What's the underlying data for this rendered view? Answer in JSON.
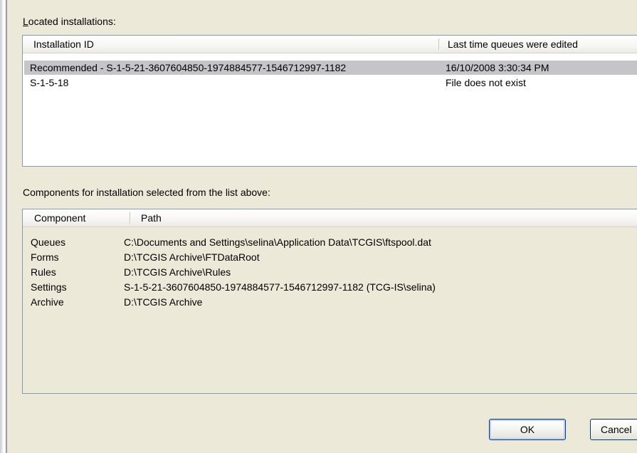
{
  "installations": {
    "label": "Located installations:",
    "columns": [
      "Installation ID",
      "Last time queues were edited"
    ],
    "rows": [
      {
        "id": "Recommended -  S-1-5-21-3607604850-1974884577-1546712997-1182",
        "edited": "16/10/2008 3:30:34 PM",
        "selected": true
      },
      {
        "id": "S-1-5-18",
        "edited": "File does not exist",
        "selected": false
      }
    ]
  },
  "components": {
    "label": "Components for installation selected from the list above:",
    "columns": [
      "Component",
      "Path"
    ],
    "rows": [
      {
        "component": "Queues",
        "path": "C:\\Documents and Settings\\selina\\Application Data\\TCGIS\\ftspool.dat"
      },
      {
        "component": "Forms",
        "path": "D:\\TCGIS Archive\\FTDataRoot"
      },
      {
        "component": "Rules",
        "path": "D:\\TCGIS Archive\\Rules"
      },
      {
        "component": "Settings",
        "path": "S-1-5-21-3607604850-1974884577-1546712997-1182 (TCG-IS\\selina)"
      },
      {
        "component": "Archive",
        "path": "D:\\TCGIS Archive"
      }
    ]
  },
  "buttons": {
    "ok": "OK",
    "cancel": "Cancel"
  },
  "colors": {
    "dialog_bg": "#ece9d8",
    "selection": "#c5c5c9",
    "list_border": "#7f9db9",
    "button_border": "#003c74"
  }
}
